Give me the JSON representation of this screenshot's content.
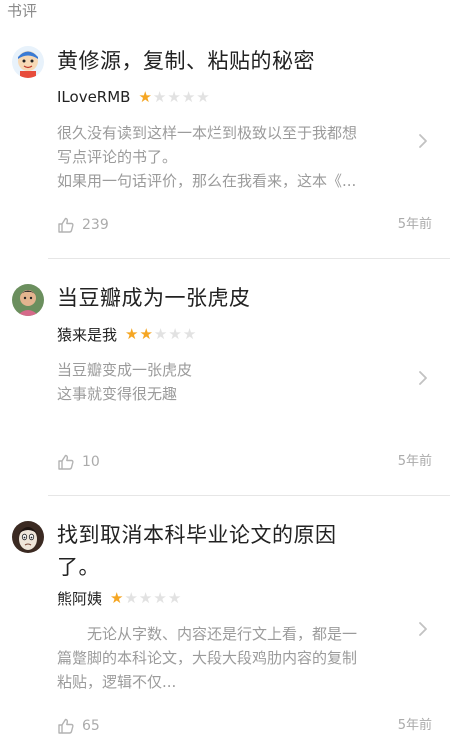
{
  "section": {
    "title": "书评"
  },
  "reviews": [
    {
      "title": "黄修源，复制、粘贴的秘密",
      "author": "ILoveRMB",
      "rating": 1,
      "rating_max": 5,
      "excerpt_lines": [
        "很久没有读到这样一本烂到极致以至于我都想",
        "写点评论的书了。",
        "如果用一句话评价，那么在我看来，这本《..."
      ],
      "likes": "239",
      "time": "5年前"
    },
    {
      "title": "当豆瓣成为一张虎皮",
      "author": "猿来是我",
      "rating": 2,
      "rating_max": 5,
      "excerpt_lines": [
        "当豆瓣变成一张虎皮",
        "这事就变得很无趣"
      ],
      "likes": "10",
      "time": "5年前"
    },
    {
      "title_lines": [
        "找到取消本科毕业论文的原因",
        "了。"
      ],
      "author": "熊阿姨",
      "rating": 1,
      "rating_max": 5,
      "excerpt_lines": [
        "　　无论从字数、内容还是行文上看，都是一",
        "篇蹩脚的本科论文，大段大段鸡肋内容的复制",
        "粘贴，逻辑不仅..."
      ],
      "likes": "65",
      "time": "5年前"
    }
  ],
  "icons": {
    "like": "thumbs-up-icon",
    "chevron": "chevron-right-icon"
  },
  "colors": {
    "star_on": "#f5a623",
    "star_off": "#e2e2e2",
    "muted_text": "#9b9b9b"
  }
}
